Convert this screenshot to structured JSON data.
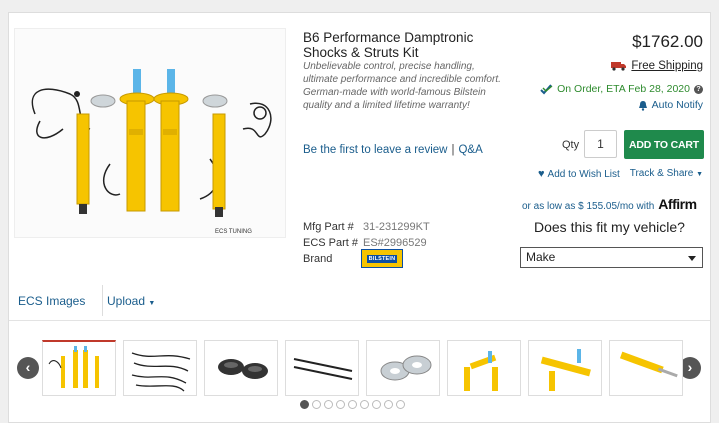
{
  "product": {
    "title": "B6 Performance Damptronic Shocks & Struts Kit",
    "description": "Unbelievable control, precise handling, ultimate performance and incredible comfort. German-made with world-famous Bilstein quality and a limited lifetime warranty!",
    "review_link": "Be the first to leave a review",
    "qa_link": "Q&A",
    "mfg_label": "Mfg Part #",
    "mfg_value": "31-231299KT",
    "ecs_label": "ECS Part #",
    "ecs_value": "ES#2996529",
    "brand_label": "Brand",
    "brand_logo_text": "BILSTEIN"
  },
  "purchase": {
    "price": "$1762.00",
    "free_shipping": "Free Shipping",
    "availability": "On Order, ETA Feb 28, 2020",
    "auto_notify": "Auto Notify",
    "qty_label": "Qty",
    "qty_value": "1",
    "add_to_cart": "ADD TO CART",
    "wish_list": "Add to Wish List",
    "track_share": "Track & Share",
    "affirm_text": "or as low as $ 155.05/mo with",
    "affirm_logo": "Affirm",
    "fitment_question": "Does this fit my vehicle?",
    "make_select": "Make"
  },
  "tabs": [
    "ECS Images",
    "Upload"
  ],
  "gallery": {
    "thumbnails": [
      "shocks-struts-kit",
      "wiring-harness",
      "bump-stops",
      "sensor-cables",
      "strut-mounts",
      "front-struts",
      "front-struts-alt",
      "rear-shock"
    ],
    "active_index": 0,
    "dot_count": 9,
    "active_dot": 0
  },
  "colors": {
    "link": "#1a5d8c",
    "cart_button": "#1f8a4c",
    "in_stock_green": "#2e8b2e",
    "strut_yellow": "#f6c400",
    "strut_blue": "#5bb5e8"
  }
}
